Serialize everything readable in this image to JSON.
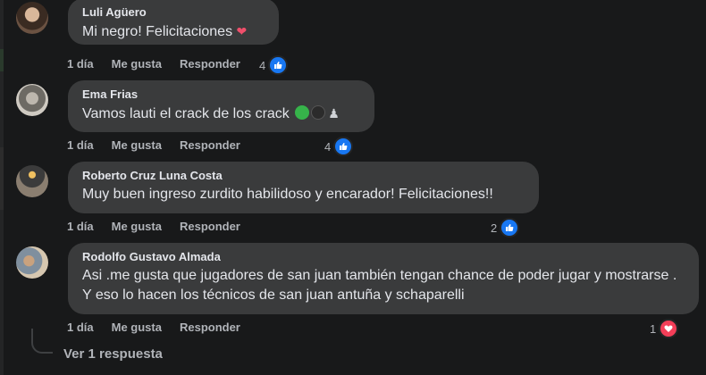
{
  "comments": [
    {
      "author": "Luli Agüero",
      "text": "Mi negro! Felicitaciones",
      "time": "1 día",
      "like": "Me gusta",
      "reply": "Responder",
      "reaction_count": "4",
      "reaction_type": "like"
    },
    {
      "author": "Ema Frias",
      "text": "Vamos lauti el crack de los crack",
      "time": "1 día",
      "like": "Me gusta",
      "reply": "Responder",
      "reaction_count": "4",
      "reaction_type": "like"
    },
    {
      "author": "Roberto Cruz Luna Costa",
      "text": "Muy buen ingreso zurdito habilidoso y encarador! Felicitaciones!!",
      "time": "1 día",
      "like": "Me gusta",
      "reply": "Responder",
      "reaction_count": "2",
      "reaction_type": "like"
    },
    {
      "author": "Rodolfo Gustavo Almada",
      "text": "Asi .me gusta que jugadores de san juan también tengan chance de poder jugar y mostrarse . Y eso lo hacen los técnicos de san juan antuña y schaparelli",
      "time": "1 día",
      "like": "Me gusta",
      "reply": "Responder",
      "reaction_count": "1",
      "reaction_type": "love"
    }
  ],
  "view_replies": "Ver 1 respuesta",
  "colors": {
    "background": "#18191a",
    "bubble": "#3a3b3c",
    "like": "#1877f2",
    "love": "#f33e58"
  }
}
